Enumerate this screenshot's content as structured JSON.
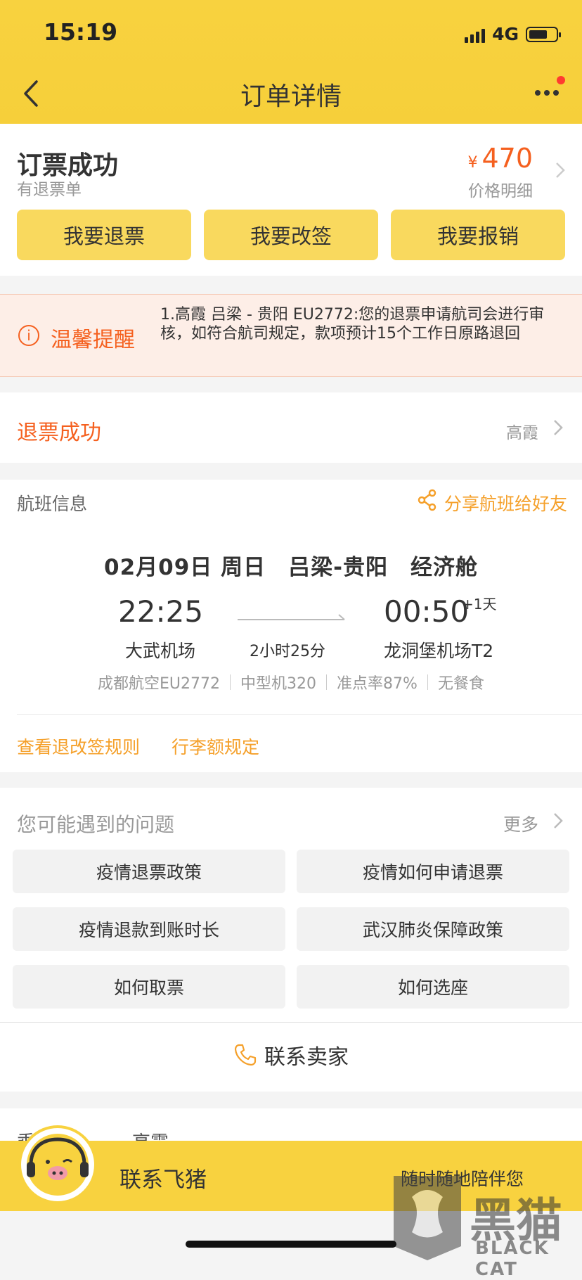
{
  "status_bar": {
    "time": "15:19",
    "network": "4G",
    "battery_level": 0.7
  },
  "nav": {
    "title": "订单详情",
    "icons": [
      "back-icon",
      "more-icon"
    ]
  },
  "order": {
    "status": "订票成功",
    "sub": "有退票单",
    "currency": "¥",
    "price": "470",
    "price_detail": "价格明细",
    "actions": [
      "我要退票",
      "我要改签",
      "我要报销"
    ]
  },
  "notice": {
    "label": "温馨提醒",
    "text": "1.高霞 吕梁 - 贵阳 EU2772:您的退票申请航司会进行审核，如符合航司规定，款项预计15个工作日原路退回"
  },
  "refund": {
    "status": "退票成功",
    "passenger": "高霞"
  },
  "flight": {
    "section_label": "航班信息",
    "share_label": "分享航班给好友",
    "date_line": "02月09日 周日　吕梁-贵阳　经济舱",
    "dep_time": "22:25",
    "arr_time": "00:50",
    "plus_day": "+1天",
    "dep_airport": "大武机场",
    "duration": "2小时25分",
    "arr_airport": "龙洞堡机场T2",
    "meta": [
      "成都航空EU2772",
      "中型机320",
      "准点率87%",
      "无餐食"
    ],
    "links": [
      "查看退改签规则",
      "行李额规定"
    ]
  },
  "faq": {
    "title": "您可能遇到的问题",
    "more": "更多",
    "items": [
      "疫情退票政策",
      "疫情如何申请退票",
      "疫情退款到账时长",
      "武汉肺炎保障政策",
      "如何取票",
      "如何选座"
    ]
  },
  "contact_seller": "联系卖家",
  "bottom": {
    "cut_left": "乘",
    "cut_right": "高霞",
    "label": "联系飞猪",
    "slogan": "随时随地陪伴您"
  },
  "watermark": {
    "text": "黑猫",
    "sub": "BLACK CAT"
  },
  "colors": {
    "brand_yellow": "#f8d23f",
    "accent_orange": "#f5601f",
    "link_orange": "#f5a02a"
  }
}
